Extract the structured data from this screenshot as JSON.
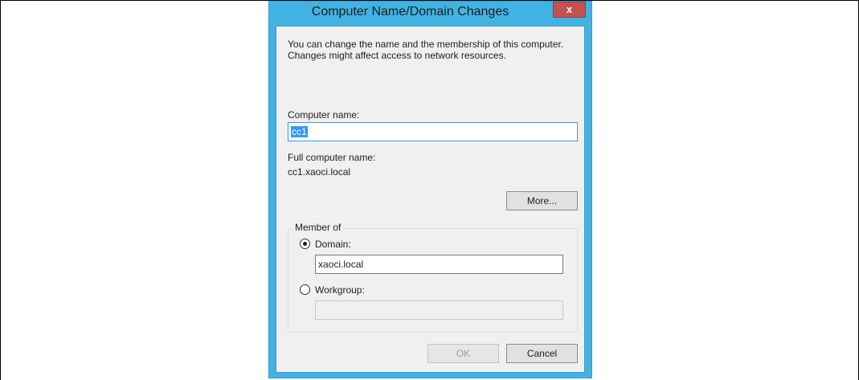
{
  "dialog": {
    "title": "Computer Name/Domain Changes",
    "close_label": "x",
    "description": "You can change the name and the membership of this computer. Changes might affect access to network resources.",
    "computer_name_label": "Computer name:",
    "computer_name_value": "cc1",
    "full_name_label": "Full computer name:",
    "full_name_value": "cc1.xaoci.local",
    "more_button": "More...",
    "member_of": {
      "title": "Member of",
      "domain_label": "Domain:",
      "domain_value": "xaoci.local",
      "domain_selected": true,
      "workgroup_label": "Workgroup:",
      "workgroup_value": "",
      "workgroup_selected": false
    },
    "ok_button": "OK",
    "ok_enabled": false,
    "cancel_button": "Cancel"
  },
  "colors": {
    "accent_border": "#41b3e3",
    "close_button": "#c75050",
    "selection": "#3399ff"
  }
}
